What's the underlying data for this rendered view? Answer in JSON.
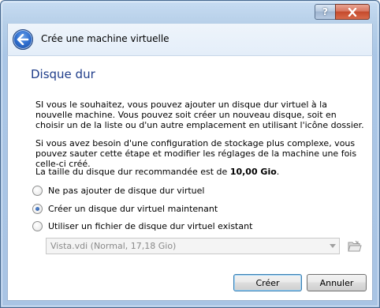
{
  "window": {
    "header_title": "Crée une machine virtuelle",
    "help_button": "?",
    "close_icon": "close-icon",
    "back_icon": "back-arrow-icon"
  },
  "page": {
    "title": "Disque dur",
    "paragraph1": "SI vous le souhaitez, vous pouvez ajouter un disque dur virtuel à la nouvelle machine. Vous pouvez soit créer un nouveau disque, soit en choisir un de la liste ou d'un autre emplacement en utilisant l'icône dossier.",
    "paragraph2": "Si vous avez besoin d'une configuration de stockage plus complexe, vous pouvez sauter cette étape et modifier les réglages de la machine une fois celle-ci créé.",
    "recommended_prefix": "La taille du disque dur recommandée est de ",
    "recommended_size": "10,00 Gio",
    "recommended_suffix": "."
  },
  "options": [
    {
      "label": "Ne pas ajouter de disque dur virtuel",
      "checked": false
    },
    {
      "label": "Créer un disque dur virtuel maintenant",
      "checked": true
    },
    {
      "label": "Utiliser un fichier de disque dur virtuel existant",
      "checked": false
    }
  ],
  "disk_select": {
    "value": "Vista.vdi (Normal, 17,18 Gio)",
    "enabled": false,
    "folder_icon": "folder-icon"
  },
  "buttons": {
    "create": "Créer",
    "cancel": "Annuler"
  },
  "colors": {
    "title_blue": "#1f3d8a",
    "frame": "#a9c4e4",
    "close_red": "#c44a2c"
  }
}
